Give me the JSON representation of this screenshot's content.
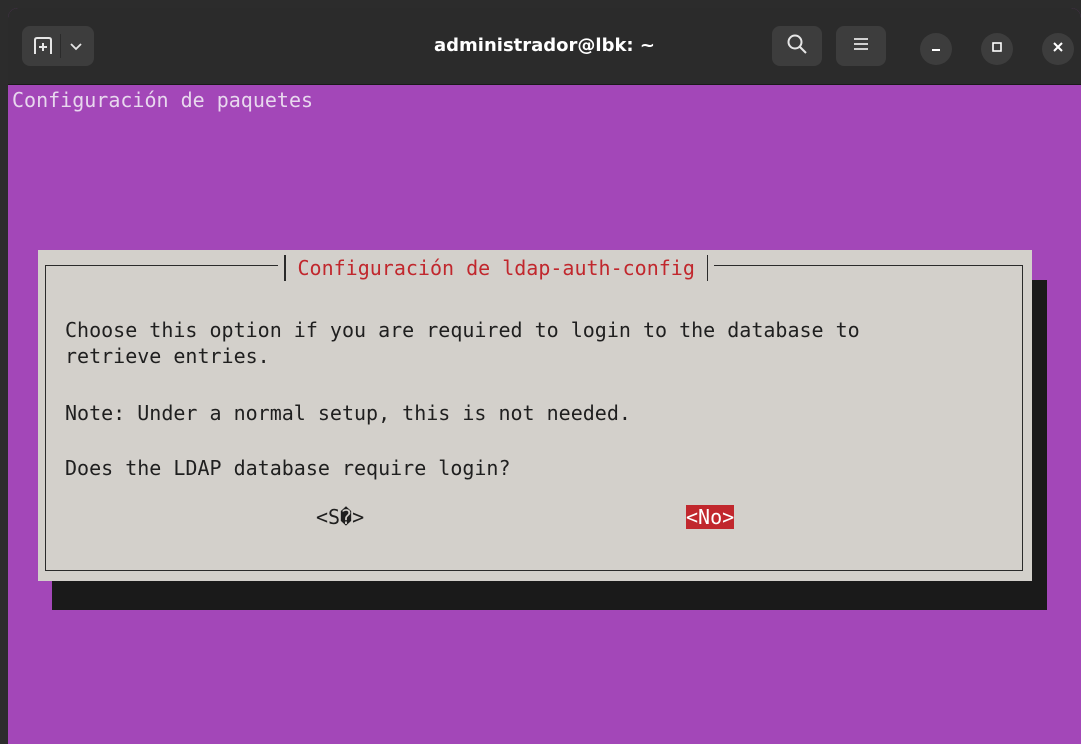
{
  "window": {
    "title": "administrador@lbk: ~",
    "icons": {
      "new_tab": "new-tab-icon",
      "dropdown": "chevron-down-icon",
      "search": "search-icon",
      "menu": "hamburger-menu-icon",
      "minimize": "minimize-icon",
      "maximize": "maximize-icon",
      "close": "close-icon"
    }
  },
  "terminal": {
    "header": "Configuración de paquetes",
    "background_color": "#a347b8"
  },
  "dialog": {
    "title": "Configuración de ldap-auth-config",
    "lines": [
      "Choose this option if you are required to login to the database to",
      "retrieve entries.",
      "Note: Under a normal setup, this is not needed.",
      "Does the LDAP database require login?"
    ],
    "yes_button": "<S�>",
    "no_button": "<No>",
    "selected_button": "No",
    "accent_color": "#c1272d"
  }
}
